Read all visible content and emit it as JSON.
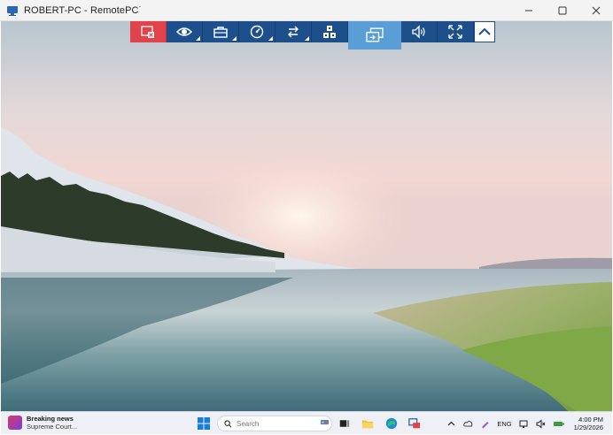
{
  "window": {
    "title": "ROBERT-PC - RemotePC",
    "title_suffix": "˙",
    "controls": [
      "minimize-icon",
      "maximize-icon",
      "close-icon"
    ]
  },
  "toolbar": {
    "buttons": [
      {
        "name": "disconnect-button",
        "icon": "disconnect-icon",
        "color": "#e2434a"
      },
      {
        "name": "view-button",
        "icon": "eye-icon",
        "has_menu": true
      },
      {
        "name": "tools-button",
        "icon": "toolbox-icon",
        "has_menu": true
      },
      {
        "name": "performance-button",
        "icon": "speedometer-icon",
        "has_menu": true
      },
      {
        "name": "transfer-button",
        "icon": "transfer-arrows-icon",
        "has_menu": true
      },
      {
        "name": "keyboard-button",
        "icon": "keys-icon"
      },
      {
        "name": "switch-monitor-button",
        "icon": "multi-monitor-icon",
        "active": true,
        "color": "#5a9ed8"
      },
      {
        "name": "sound-button",
        "icon": "speaker-icon"
      },
      {
        "name": "fullscreen-button",
        "icon": "expand-icon"
      },
      {
        "name": "collapse-toolbar-button",
        "icon": "chevron-up-icon"
      }
    ],
    "bar_color": "#1d4f8b"
  },
  "taskbar": {
    "widget": {
      "title": "Breaking news",
      "subtitle": "Supreme Court..."
    },
    "search": {
      "placeholder": "Search"
    },
    "pinned_apps": [
      "windows-start-icon",
      "task-view-icon",
      "file-explorer-icon",
      "edge-icon",
      "remotepc-icon"
    ],
    "tray": {
      "language": "ENG",
      "time": "4:00 PM",
      "date": "1/29/2026"
    }
  }
}
